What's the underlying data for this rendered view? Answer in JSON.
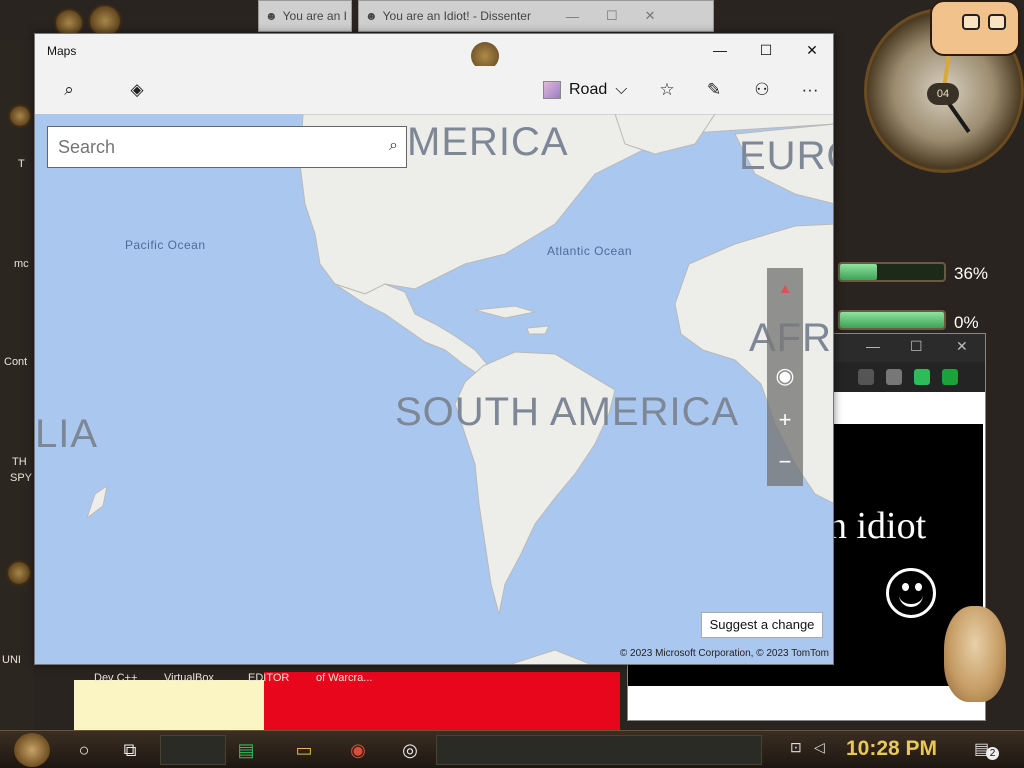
{
  "desktop": {
    "labels_bottom": [
      "Dev C++",
      "VirtualBox",
      "EDITOR",
      "of Warcra..."
    ],
    "labels_left": [
      "T",
      "mc",
      "Cont",
      "TH",
      "SPY",
      "UNI"
    ],
    "meters": [
      {
        "value_pct": 36,
        "label": "36%"
      },
      {
        "value_pct": 0,
        "label": "0%"
      }
    ],
    "clock_face_number": "04"
  },
  "bg_windows": [
    {
      "title": "You are an I"
    },
    {
      "title": "You are an Idiot! - Dissenter"
    }
  ],
  "idiot_window": {
    "text": "n idiot"
  },
  "maps": {
    "title": "Maps",
    "map_style": "Road",
    "search_placeholder": "Search",
    "oceans": {
      "pacific": "Pacific Ocean",
      "atlantic": "Atlantic Ocean"
    },
    "continents": {
      "north_america": "MERICA",
      "south_america": "SOUTH AMERICA",
      "europe": "EURO",
      "africa": "AFRI",
      "australia": "LIA"
    },
    "suggest_label": "Suggest a change",
    "copyright": "© 2023 Microsoft Corporation, © 2023 TomTom",
    "controls": {
      "compass": "▲",
      "locate": "◉",
      "zoom_in": "+",
      "zoom_out": "−"
    },
    "toolbar_icons": {
      "search": "⌕",
      "directions": "◈",
      "favorites": "☆",
      "ink": "✎",
      "account": "⚇",
      "more": "···"
    }
  },
  "taskbar": {
    "time": "10:28 PM",
    "notification_count": "2"
  }
}
